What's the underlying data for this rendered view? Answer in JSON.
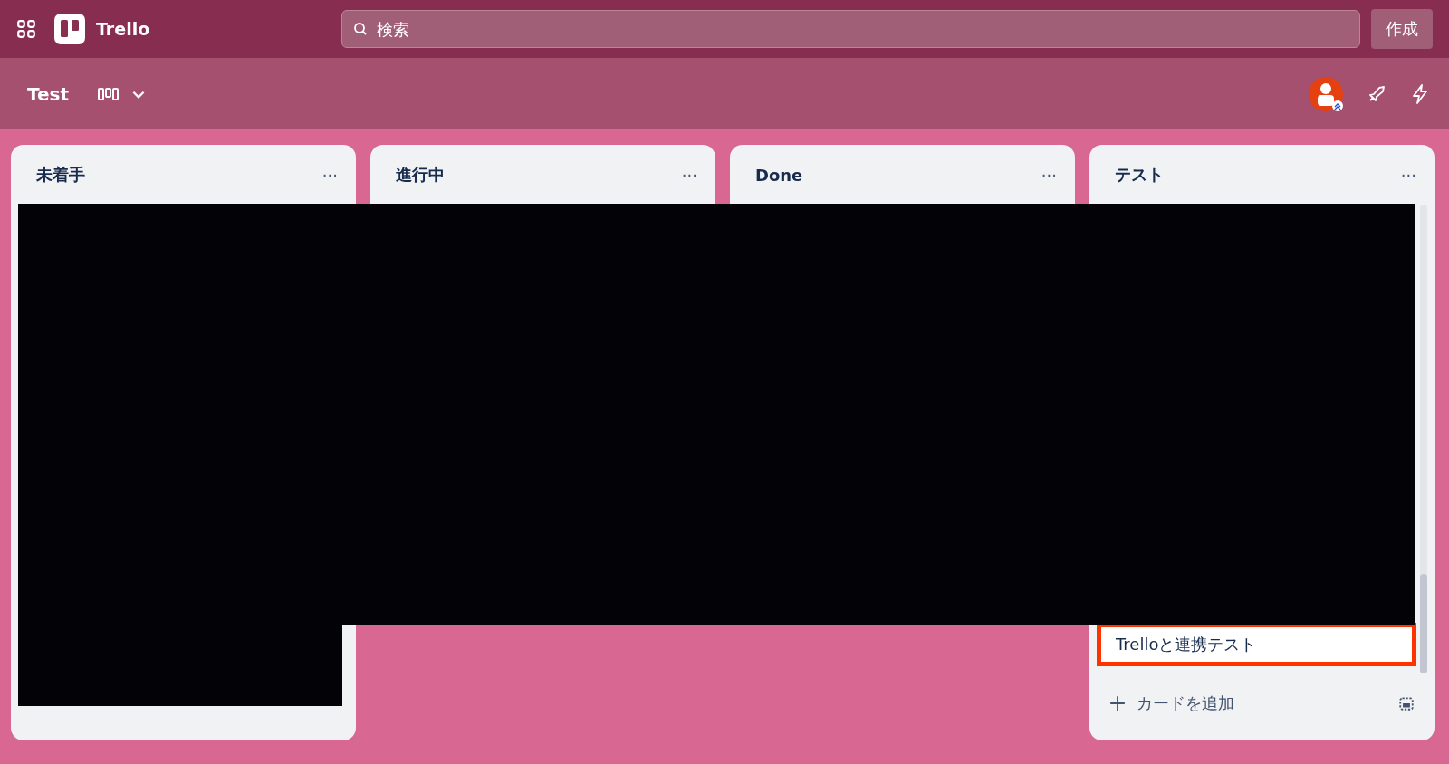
{
  "topbar": {
    "logo": "Trello",
    "search": {
      "placeholder": "検索"
    },
    "create_button": "作成"
  },
  "board": {
    "title": "Test"
  },
  "lists": [
    {
      "kind": "tall",
      "title": "未着手",
      "menu": "···"
    },
    {
      "kind": "short",
      "title": "進行中",
      "menu": "···"
    },
    {
      "kind": "short",
      "title": "Done",
      "menu": "···"
    },
    {
      "kind": "tall",
      "title": "テスト",
      "menu": "···",
      "cards": [
        {
          "title": "Trelloと連携テスト",
          "highlighted": true
        }
      ],
      "add_card": "カードを追加"
    }
  ]
}
